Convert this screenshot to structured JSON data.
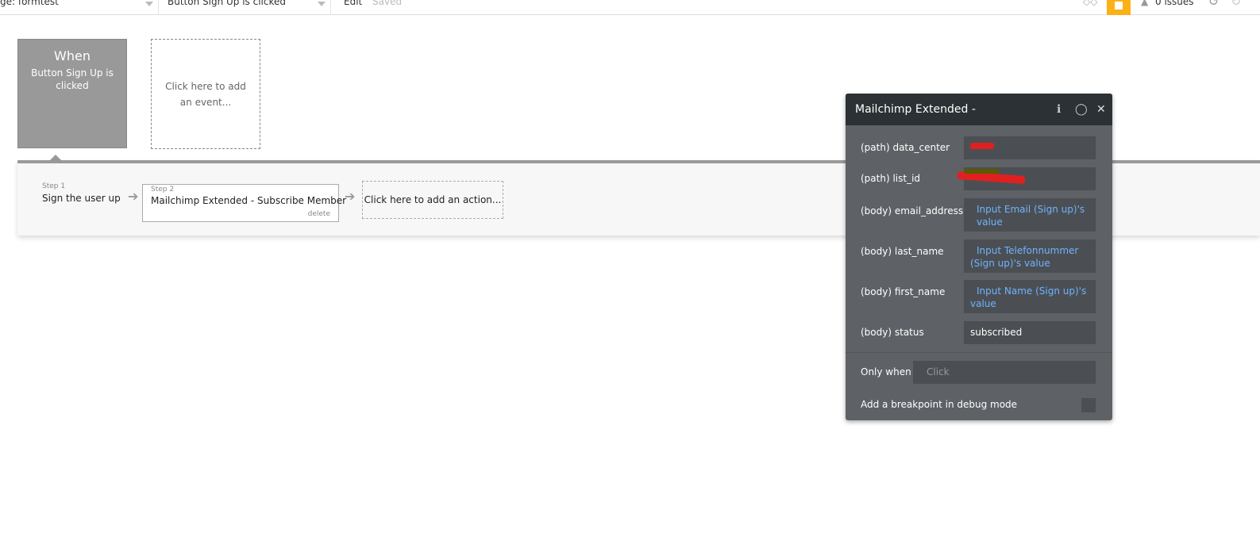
{
  "topbar": {
    "page_select": "ge: formtest",
    "event_select": "Button Sign Up is clicked",
    "edit": "Edit",
    "saved": "Saved",
    "issues": "0 issues"
  },
  "event": {
    "when": "When",
    "trigger": "Button Sign Up is clicked",
    "add_event": "Click here to add an event..."
  },
  "steps": [
    {
      "label": "Step 1",
      "title": "Sign the user up"
    },
    {
      "label": "Step 2",
      "title": "Mailchimp Extended - Subscribe Member",
      "delete": "delete"
    }
  ],
  "add_action": "Click here to add an action...",
  "panel": {
    "title": "Mailchimp Extended - Subscribe Member",
    "fields": [
      {
        "label": "(path) data_center",
        "value": ""
      },
      {
        "label": "(path) list_id",
        "value": ""
      },
      {
        "label": "(body) email_address",
        "value": "Input Email (Sign up)'s value"
      },
      {
        "label": "(body) last_name",
        "value": "Input Telefonnummer (Sign up)'s value"
      },
      {
        "label": "(body) first_name",
        "value": "Input Name (Sign up)'s value"
      },
      {
        "label": "(body) status",
        "value": "subscribed"
      }
    ],
    "only_when": "Only when",
    "only_when_placeholder": "Click",
    "breakpoint": "Add a breakpoint in debug mode"
  },
  "colors": {
    "accent": "#fbb117",
    "dynamic": "#6fb3ff",
    "panel": "#5e6266",
    "header": "#2b3134"
  }
}
